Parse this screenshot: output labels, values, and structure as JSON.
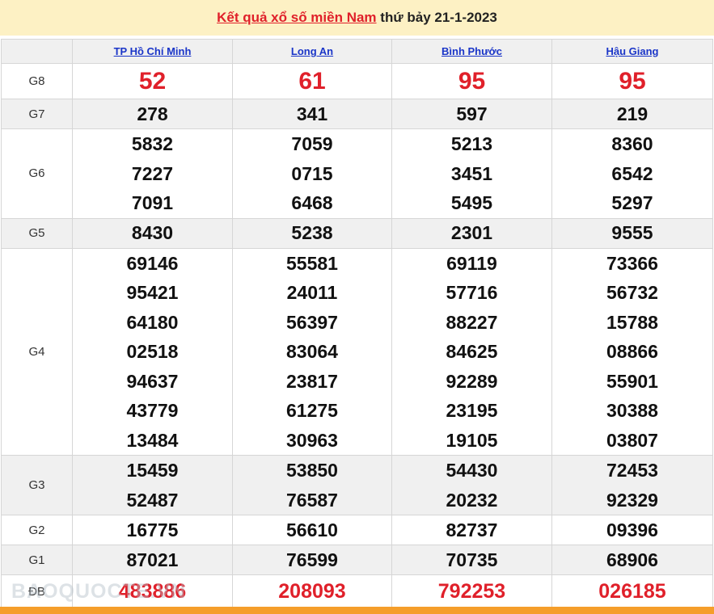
{
  "header": {
    "title_link": "Kết quả xổ số miền Nam",
    "date_text": "thứ bảy 21-1-2023"
  },
  "provinces": [
    "TP Hồ Chí Minh",
    "Long An",
    "Bình Phước",
    "Hậu Giang"
  ],
  "prizes": {
    "g8": {
      "label": "G8",
      "values": [
        "52",
        "61",
        "95",
        "95"
      ]
    },
    "g7": {
      "label": "G7",
      "values": [
        "278",
        "341",
        "597",
        "219"
      ]
    },
    "g6": {
      "label": "G6",
      "values": [
        [
          "5832",
          "7227",
          "7091"
        ],
        [
          "7059",
          "0715",
          "6468"
        ],
        [
          "5213",
          "3451",
          "5495"
        ],
        [
          "8360",
          "6542",
          "5297"
        ]
      ]
    },
    "g5": {
      "label": "G5",
      "values": [
        "8430",
        "5238",
        "2301",
        "9555"
      ]
    },
    "g4": {
      "label": "G4",
      "values": [
        [
          "69146",
          "95421",
          "64180",
          "02518",
          "94637",
          "43779",
          "13484"
        ],
        [
          "55581",
          "24011",
          "56397",
          "83064",
          "23817",
          "61275",
          "30963"
        ],
        [
          "69119",
          "57716",
          "88227",
          "84625",
          "92289",
          "23195",
          "19105"
        ],
        [
          "73366",
          "56732",
          "15788",
          "08866",
          "55901",
          "30388",
          "03807"
        ]
      ]
    },
    "g3": {
      "label": "G3",
      "values": [
        [
          "15459",
          "52487"
        ],
        [
          "53850",
          "76587"
        ],
        [
          "54430",
          "20232"
        ],
        [
          "72453",
          "92329"
        ]
      ]
    },
    "g2": {
      "label": "G2",
      "values": [
        "16775",
        "56610",
        "82737",
        "09396"
      ]
    },
    "g1": {
      "label": "G1",
      "values": [
        "87021",
        "76599",
        "70735",
        "68906"
      ]
    },
    "db": {
      "label": "ĐB",
      "values": [
        "483886",
        "208093",
        "792253",
        "026185"
      ]
    }
  },
  "watermark": "BAOQUOCTE.VN",
  "colors": {
    "header_bg": "#fdf1c4",
    "accent_red": "#e0202a",
    "link_blue": "#1a35c8",
    "row_shade": "#f0f0f0",
    "footer_orange": "#f59e2a"
  }
}
